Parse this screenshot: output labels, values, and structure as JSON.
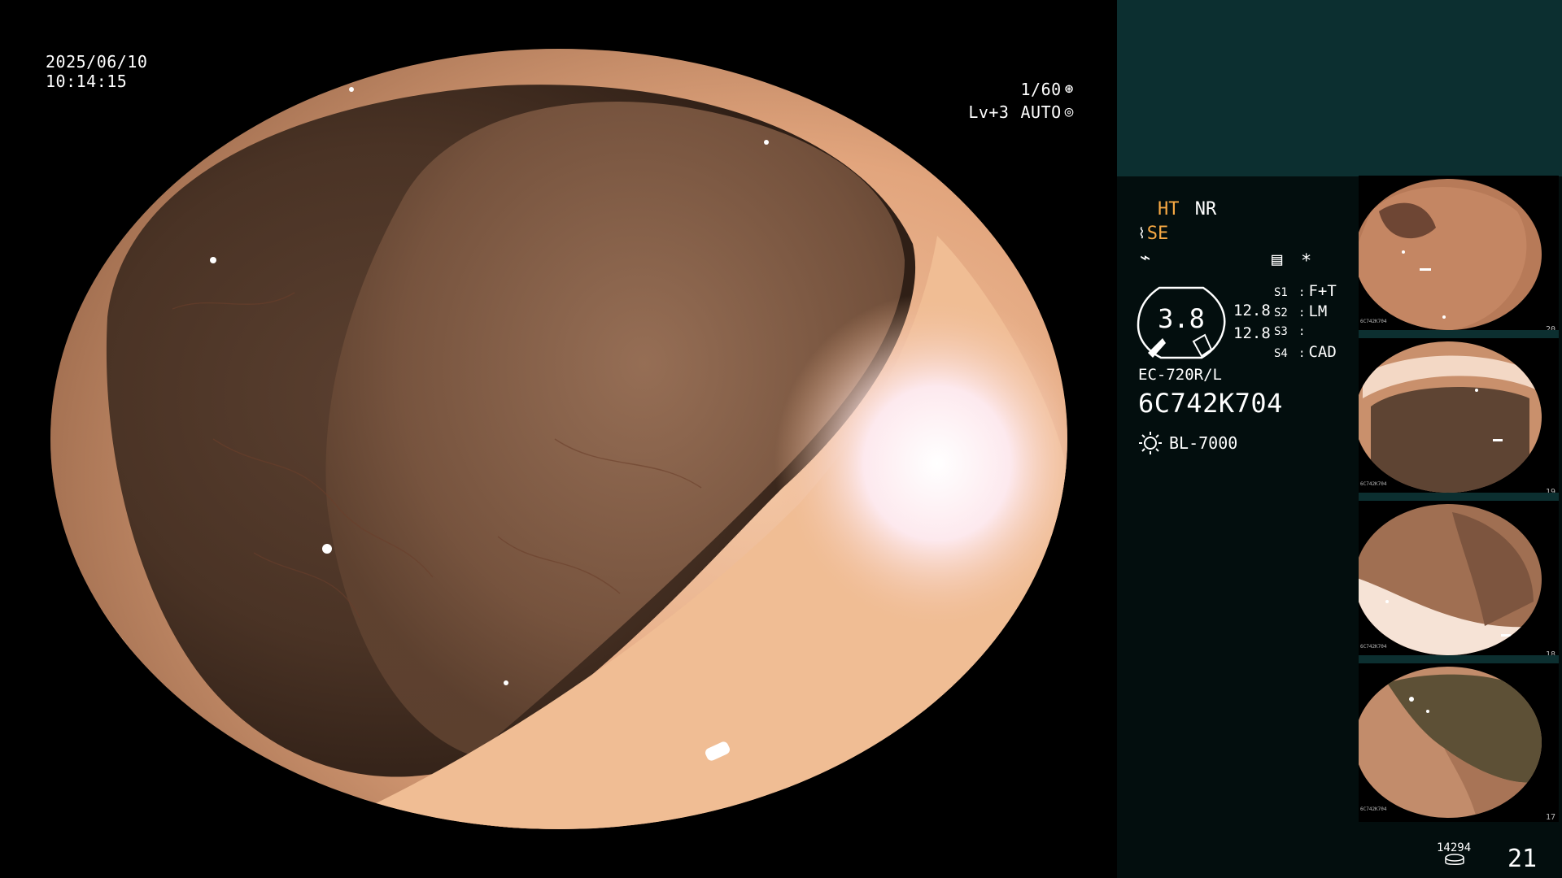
{
  "overlay": {
    "date": "2025/06/10",
    "time": "10:14:15",
    "shutter": "1/60",
    "shutter_icon": "aperture-icon",
    "level": "Lv+3",
    "exposure_mode": "AUTO",
    "exposure_icon": "target-icon"
  },
  "panel": {
    "ht_label": "HT",
    "nr_label": "NR",
    "se_label": "SE",
    "se_icon": "wave-icon",
    "mode_icon": "zigzag-icon",
    "settings_icon": "menu-icon",
    "asterisk": "*",
    "gauge_value": "3.8",
    "readout_1": "12.8",
    "readout_2": "12.8",
    "switches": [
      {
        "key": "S1",
        "value": "F+T"
      },
      {
        "key": "S2",
        "value": "LM"
      },
      {
        "key": "S3",
        "value": ""
      },
      {
        "key": "S4",
        "value": "CAD"
      }
    ],
    "scope_model": "EC-720R/L",
    "scope_serial": "6C742K704",
    "light_icon": "light-source-icon",
    "light_source": "BL-7000",
    "disk_count": "14294",
    "disk_icon": "disk-icon",
    "image_count": "21"
  },
  "thumbnails": [
    {
      "label": "6C742K704",
      "index": "20"
    },
    {
      "label": "6C742K704",
      "index": "19"
    },
    {
      "label": "6C742K704",
      "index": "18"
    },
    {
      "label": "6C742K704",
      "index": "17"
    }
  ],
  "colors": {
    "panel_bg": "#030e0e",
    "panel_top": "#0c2f30",
    "accent_orange": "#f7a944"
  }
}
